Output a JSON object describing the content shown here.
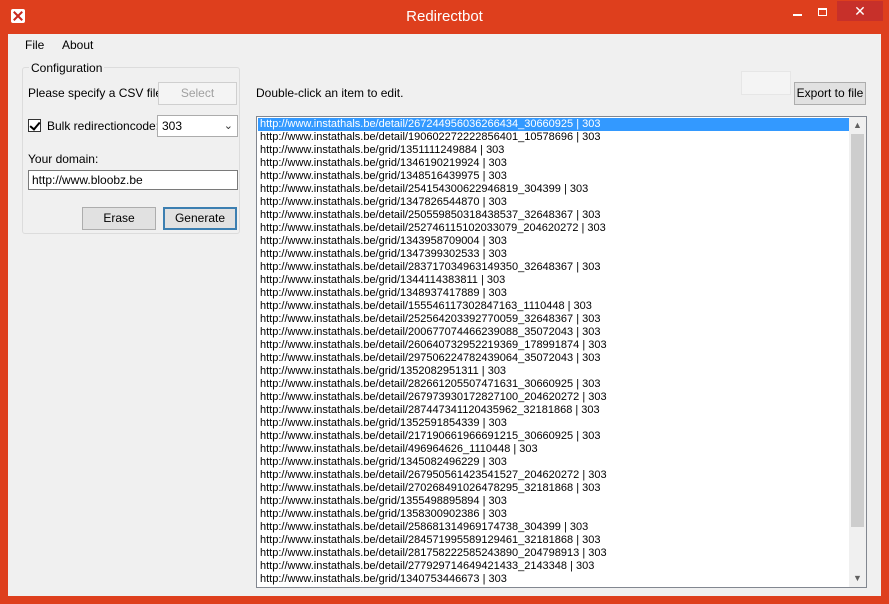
{
  "window": {
    "title": "Redirectbot"
  },
  "menu": {
    "file": "File",
    "about": "About"
  },
  "config": {
    "legend": "Configuration",
    "csv_label": "Please specify a CSV file",
    "select_button": "Select",
    "bulk_label": "Bulk redirectioncode:",
    "bulk_checked": true,
    "bulk_value": "303",
    "domain_label": "Your domain:",
    "domain_value": "http://www.bloobz.be"
  },
  "actions": {
    "erase": "Erase",
    "generate": "Generate"
  },
  "main": {
    "hint": "Double-click an item to edit.",
    "export_button": "Export to file",
    "selected_index": 0,
    "items": [
      "http://www.instathals.be/detail/267244956036266434_30660925 | 303",
      "http://www.instathals.be/detail/190602272222856401_10578696 | 303",
      "http://www.instathals.be/grid/1351111249884 | 303",
      "http://www.instathals.be/grid/1346190219924 | 303",
      "http://www.instathals.be/grid/1348516439975 | 303",
      "http://www.instathals.be/detail/254154300622946819_304399 | 303",
      "http://www.instathals.be/grid/1347826544870 | 303",
      "http://www.instathals.be/detail/250559850318438537_32648367 | 303",
      "http://www.instathals.be/detail/252746115102033079_204620272 | 303",
      "http://www.instathals.be/grid/1343958709004 | 303",
      "http://www.instathals.be/grid/1347399302533 | 303",
      "http://www.instathals.be/detail/283717034963149350_32648367 | 303",
      "http://www.instathals.be/grid/1344114383811 | 303",
      "http://www.instathals.be/grid/1348937417889 | 303",
      "http://www.instathals.be/detail/155546117302847163_1110448 | 303",
      "http://www.instathals.be/detail/252564203392770059_32648367 | 303",
      "http://www.instathals.be/detail/200677074466239088_35072043 | 303",
      "http://www.instathals.be/detail/260640732952219369_178991874 | 303",
      "http://www.instathals.be/detail/297506224782439064_35072043 | 303",
      "http://www.instathals.be/grid/1352082951311 | 303",
      "http://www.instathals.be/detail/282661205507471631_30660925 | 303",
      "http://www.instathals.be/detail/267973930172827100_204620272 | 303",
      "http://www.instathals.be/detail/287447341120435962_32181868 | 303",
      "http://www.instathals.be/grid/1352591854339 | 303",
      "http://www.instathals.be/detail/217190661966691215_30660925 | 303",
      "http://www.instathals.be/detail/496964626_1110448 | 303",
      "http://www.instathals.be/grid/1345082496229 | 303",
      "http://www.instathals.be/detail/267950561423541527_204620272 | 303",
      "http://www.instathals.be/detail/270268491026478295_32181868 | 303",
      "http://www.instathals.be/grid/1355498895894 | 303",
      "http://www.instathals.be/grid/1358300902386 | 303",
      "http://www.instathals.be/detail/258681314969174738_304399 | 303",
      "http://www.instathals.be/detail/284571995589129461_32181868 | 303",
      "http://www.instathals.be/detail/281758222585243890_204798913 | 303",
      "http://www.instathals.be/detail/277929714649421433_2143348 | 303",
      "http://www.instathals.be/grid/1340753446673 | 303"
    ]
  }
}
